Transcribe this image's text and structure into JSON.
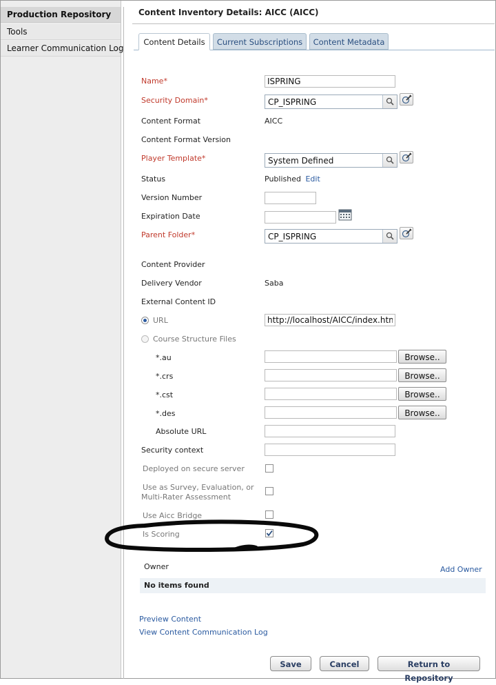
{
  "sidebar": {
    "items": [
      {
        "label": "Production Repository",
        "active": true
      },
      {
        "label": "Tools"
      },
      {
        "label": "Learner Communication Log"
      }
    ]
  },
  "page": {
    "title": "Content Inventory Details: AICC (AICC)"
  },
  "tabs": [
    {
      "label": "Content Details",
      "active": true
    },
    {
      "label": "Current Subscriptions"
    },
    {
      "label": "Content Metadata"
    }
  ],
  "form": {
    "name": {
      "label": "Name*",
      "value": "ISPRING"
    },
    "security_domain": {
      "label": "Security Domain*",
      "value": "CP_ISPRING"
    },
    "content_format": {
      "label": "Content Format",
      "value": "AICC"
    },
    "content_format_version": {
      "label": "Content Format Version",
      "value": ""
    },
    "player_template": {
      "label": "Player Template*",
      "value": "System Defined"
    },
    "status": {
      "label": "Status",
      "value": "Published",
      "edit_label": "Edit"
    },
    "version_number": {
      "label": "Version Number",
      "value": ""
    },
    "expiration_date": {
      "label": "Expiration Date",
      "value": ""
    },
    "parent_folder": {
      "label": "Parent Folder*",
      "value": "CP_ISPRING"
    },
    "content_provider": {
      "label": "Content Provider",
      "value": ""
    },
    "delivery_vendor": {
      "label": "Delivery Vendor",
      "value": "Saba"
    },
    "external_content_id": {
      "label": "External Content ID"
    },
    "url_option": {
      "label": "URL",
      "value": "http://localhost/AICC/index.html",
      "selected": true
    },
    "structure_option": {
      "label": "Course Structure Files",
      "selected": false
    },
    "files": [
      {
        "label": "*.au",
        "value": "",
        "button": "Browse.."
      },
      {
        "label": "*.crs",
        "value": "",
        "button": "Browse.."
      },
      {
        "label": "*.cst",
        "value": "",
        "button": "Browse.."
      },
      {
        "label": "*.des",
        "value": "",
        "button": "Browse.."
      }
    ],
    "absolute_url": {
      "label": "Absolute URL",
      "value": ""
    },
    "security_context": {
      "label": "Security context",
      "value": ""
    },
    "deployed_secure": {
      "label": "Deployed on secure server",
      "checked": false
    },
    "survey_line1": "Use as Survey, Evaluation, or",
    "survey_line2": "Multi-Rater Assessment",
    "survey_checked": false,
    "aicc_bridge": {
      "label": "Use Aicc Bridge",
      "checked": false
    },
    "is_scoring": {
      "label": "Is Scoring",
      "checked": true
    }
  },
  "owner": {
    "header": "Owner",
    "add_label": "Add Owner",
    "empty_text": "No items found"
  },
  "links": {
    "preview": "Preview Content",
    "comm_log": "View Content Communication Log"
  },
  "buttons": {
    "save": "Save",
    "cancel": "Cancel",
    "return": "Return to Repository"
  },
  "colors": {
    "required_label": "#c0392b",
    "link": "#2a5aa0",
    "tab_inactive_bg": "#d2dde7"
  }
}
